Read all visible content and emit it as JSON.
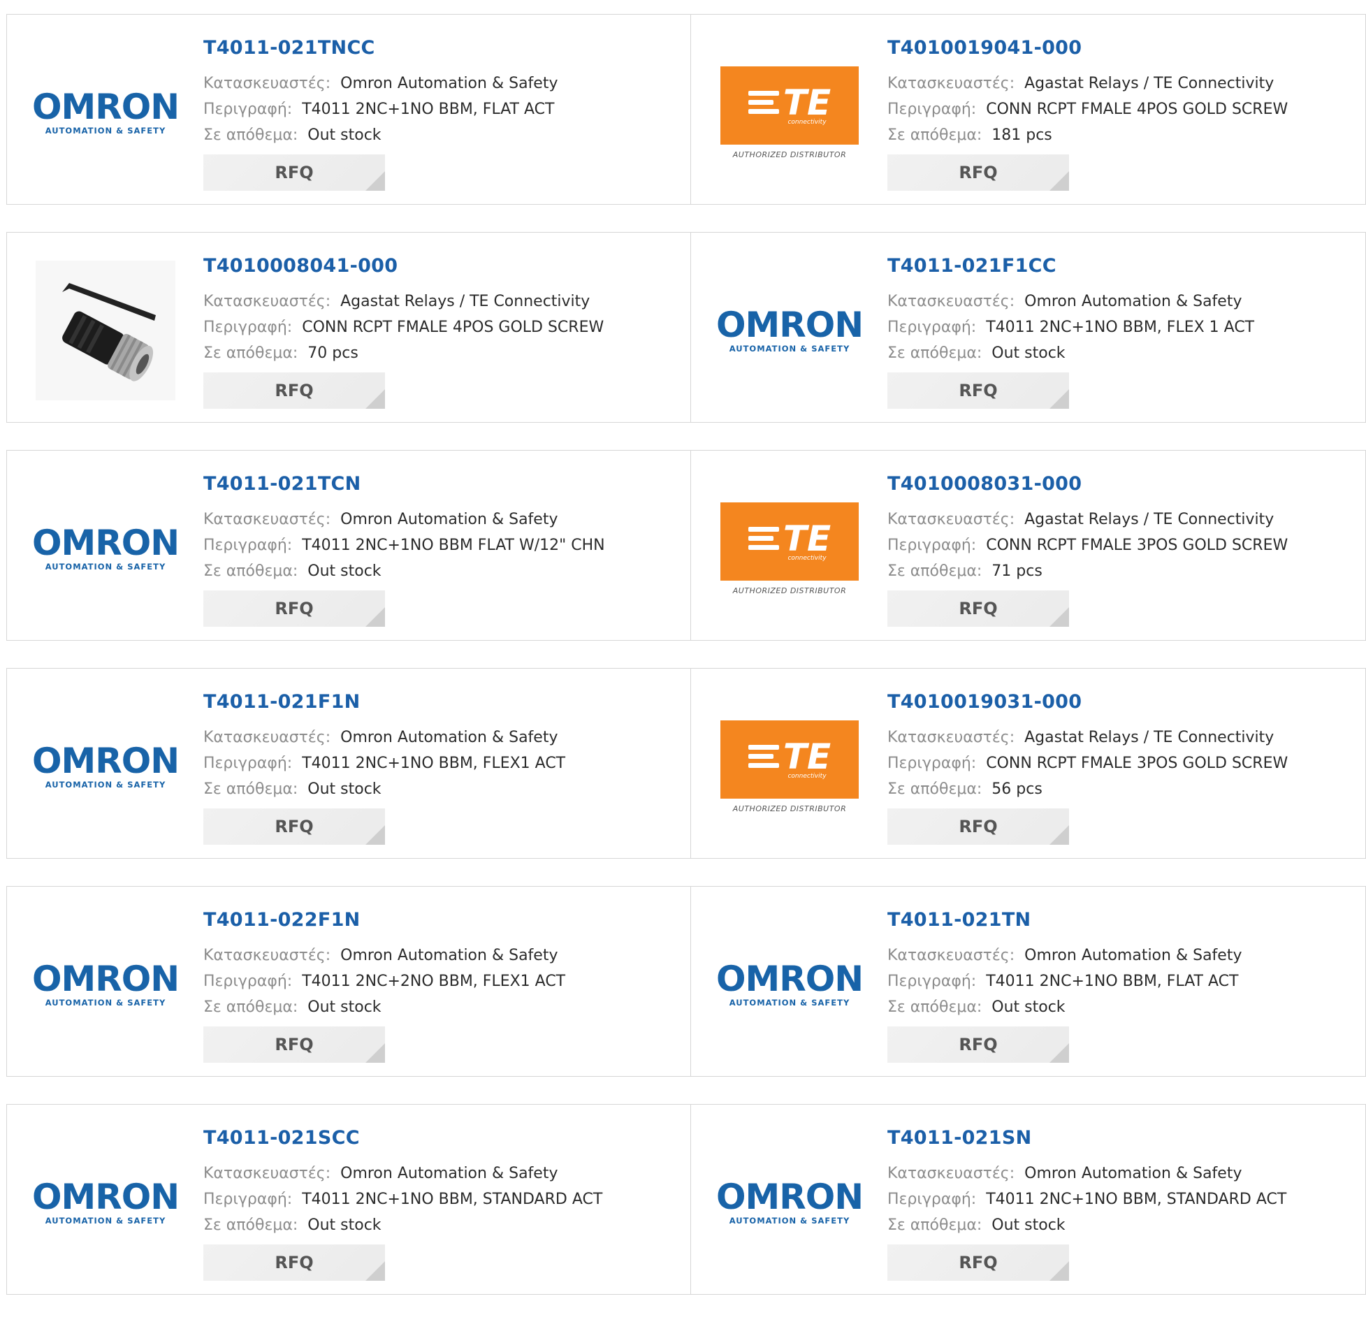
{
  "labels": {
    "manufacturer": "Κατασκευαστές:",
    "description": "Περιγραφή:",
    "stock": "Σε απόθεμα:",
    "rfq": "RFQ"
  },
  "logos": {
    "omron_word": "OMRON",
    "omron_sub": "AUTOMATION & SAFETY",
    "te_letters": "TE",
    "te_connectivity": "connectivity",
    "te_authorized": "AUTHORIZED DISTRIBUTOR"
  },
  "products": [
    {
      "part": "T4011-021TNCC",
      "manufacturer": "Omron Automation & Safety",
      "description": "T4011 2NC+1NO BBM, FLAT ACT",
      "stock": "Out stock",
      "logo": "omron"
    },
    {
      "part": "T4010019041-000",
      "manufacturer": "Agastat Relays / TE Connectivity",
      "description": "CONN RCPT FMALE 4POS GOLD SCREW",
      "stock": "181 pcs",
      "logo": "te"
    },
    {
      "part": "T4010008041-000",
      "manufacturer": "Agastat Relays / TE Connectivity",
      "description": "CONN RCPT FMALE 4POS GOLD SCREW",
      "stock": "70 pcs",
      "logo": "photo"
    },
    {
      "part": "T4011-021F1CC",
      "manufacturer": "Omron Automation & Safety",
      "description": "T4011 2NC+1NO BBM, FLEX 1 ACT",
      "stock": "Out stock",
      "logo": "omron"
    },
    {
      "part": "T4011-021TCN",
      "manufacturer": "Omron Automation & Safety",
      "description": "T4011 2NC+1NO BBM FLAT W/12\" CHN",
      "stock": "Out stock",
      "logo": "omron"
    },
    {
      "part": "T4010008031-000",
      "manufacturer": "Agastat Relays / TE Connectivity",
      "description": "CONN RCPT FMALE 3POS GOLD SCREW",
      "stock": "71 pcs",
      "logo": "te"
    },
    {
      "part": "T4011-021F1N",
      "manufacturer": "Omron Automation & Safety",
      "description": "T4011 2NC+1NO BBM, FLEX1 ACT",
      "stock": "Out stock",
      "logo": "omron"
    },
    {
      "part": "T4010019031-000",
      "manufacturer": "Agastat Relays / TE Connectivity",
      "description": "CONN RCPT FMALE 3POS GOLD SCREW",
      "stock": "56 pcs",
      "logo": "te"
    },
    {
      "part": "T4011-022F1N",
      "manufacturer": "Omron Automation & Safety",
      "description": "T4011 2NC+2NO BBM, FLEX1 ACT",
      "stock": "Out stock",
      "logo": "omron"
    },
    {
      "part": "T4011-021TN",
      "manufacturer": "Omron Automation & Safety",
      "description": "T4011 2NC+1NO BBM, FLAT ACT",
      "stock": "Out stock",
      "logo": "omron"
    },
    {
      "part": "T4011-021SCC",
      "manufacturer": "Omron Automation & Safety",
      "description": "T4011 2NC+1NO BBM, STANDARD ACT",
      "stock": "Out stock",
      "logo": "omron"
    },
    {
      "part": "T4011-021SN",
      "manufacturer": "Omron Automation & Safety",
      "description": "T4011 2NC+1NO BBM, STANDARD ACT",
      "stock": "Out stock",
      "logo": "omron"
    }
  ]
}
